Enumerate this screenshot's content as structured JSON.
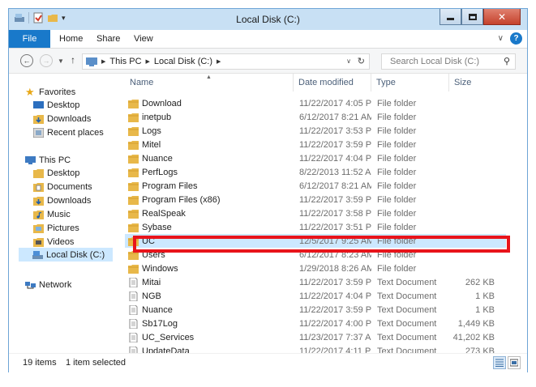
{
  "window": {
    "title": "Local Disk (C:)"
  },
  "ribbon": {
    "tabs": [
      "File",
      "Home",
      "Share",
      "View"
    ]
  },
  "address": {
    "crumbs": [
      "This PC",
      "Local Disk (C:)"
    ],
    "search_placeholder": "Search Local Disk (C:)"
  },
  "nav": {
    "favorites": "Favorites",
    "fav_items": [
      "Desktop",
      "Downloads",
      "Recent places"
    ],
    "thispc": "This PC",
    "pc_items": [
      "Desktop",
      "Documents",
      "Downloads",
      "Music",
      "Pictures",
      "Videos",
      "Local Disk (C:)"
    ],
    "network": "Network"
  },
  "columns": {
    "name": "Name",
    "date": "Date modified",
    "type": "Type",
    "size": "Size"
  },
  "files": [
    {
      "name": "Download",
      "date": "11/22/2017 4:05 PM",
      "type": "File folder",
      "size": "",
      "kind": "folder"
    },
    {
      "name": "inetpub",
      "date": "6/12/2017 8:21 AM",
      "type": "File folder",
      "size": "",
      "kind": "folder"
    },
    {
      "name": "Logs",
      "date": "11/22/2017 3:53 PM",
      "type": "File folder",
      "size": "",
      "kind": "folder"
    },
    {
      "name": "Mitel",
      "date": "11/22/2017 3:59 PM",
      "type": "File folder",
      "size": "",
      "kind": "folder"
    },
    {
      "name": "Nuance",
      "date": "11/22/2017 4:04 PM",
      "type": "File folder",
      "size": "",
      "kind": "folder"
    },
    {
      "name": "PerfLogs",
      "date": "8/22/2013 11:52 AM",
      "type": "File folder",
      "size": "",
      "kind": "folder"
    },
    {
      "name": "Program Files",
      "date": "6/12/2017 8:21 AM",
      "type": "File folder",
      "size": "",
      "kind": "folder"
    },
    {
      "name": "Program Files (x86)",
      "date": "11/22/2017 3:59 PM",
      "type": "File folder",
      "size": "",
      "kind": "folder"
    },
    {
      "name": "RealSpeak",
      "date": "11/22/2017 3:58 PM",
      "type": "File folder",
      "size": "",
      "kind": "folder"
    },
    {
      "name": "Sybase",
      "date": "11/22/2017 3:51 PM",
      "type": "File folder",
      "size": "",
      "kind": "folder"
    },
    {
      "name": "UC",
      "date": "12/5/2017 9:25 AM",
      "type": "File folder",
      "size": "",
      "kind": "folder",
      "selected": true
    },
    {
      "name": "Users",
      "date": "6/12/2017 8:23 AM",
      "type": "File folder",
      "size": "",
      "kind": "folder"
    },
    {
      "name": "Windows",
      "date": "1/29/2018 8:26 AM",
      "type": "File folder",
      "size": "",
      "kind": "folder"
    },
    {
      "name": "Mitai",
      "date": "11/22/2017 3:59 PM",
      "type": "Text Document",
      "size": "262 KB",
      "kind": "doc"
    },
    {
      "name": "NGB",
      "date": "11/22/2017 4:04 PM",
      "type": "Text Document",
      "size": "1 KB",
      "kind": "doc"
    },
    {
      "name": "Nuance",
      "date": "11/22/2017 3:59 PM",
      "type": "Text Document",
      "size": "1 KB",
      "kind": "doc"
    },
    {
      "name": "Sb17Log",
      "date": "11/22/2017 4:00 PM",
      "type": "Text Document",
      "size": "1,449 KB",
      "kind": "doc"
    },
    {
      "name": "UC_Services",
      "date": "11/23/2017 7:37 AM",
      "type": "Text Document",
      "size": "41,202 KB",
      "kind": "doc"
    },
    {
      "name": "UpdateData",
      "date": "11/22/2017 4:11 PM",
      "type": "Text Document",
      "size": "273 KB",
      "kind": "doc"
    }
  ],
  "status": {
    "count": "19 items",
    "selected": "1 item selected"
  },
  "colors": {
    "accent": "#1979ca",
    "selection": "#cce8ff",
    "highlight_box": "#e8141b",
    "folder": "#e8b84a"
  }
}
